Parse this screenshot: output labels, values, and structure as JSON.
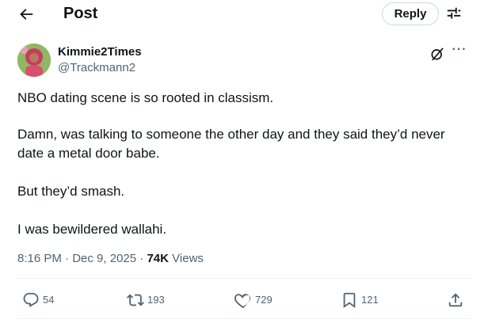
{
  "header": {
    "title": "Post",
    "reply_label": "Reply",
    "back_icon": "arrow-left-icon",
    "adjust_icon": "sliders-icon"
  },
  "author": {
    "display_name": "Kimmie2Times",
    "handle": "@Trackmann2",
    "grok_icon": "grok-icon",
    "more_label": "···"
  },
  "tweet": {
    "paragraphs": [
      "NBO dating scene is so rooted in classism.",
      "Damn, was talking to someone the other day and they said they’d never date a metal door babe.",
      "But they’d smash.",
      "I was bewildered wallahi."
    ]
  },
  "meta": {
    "time": "8:16 PM",
    "separator": " · ",
    "date": "Dec 9, 2025",
    "views_count": "74K",
    "views_label": "Views"
  },
  "actions": {
    "replies": "54",
    "reposts": "193",
    "likes": "729",
    "bookmarks": "121"
  },
  "colors": {
    "text": "#0f1419",
    "secondary": "#536471",
    "border": "#cfd9de",
    "divider": "#eff3f4"
  }
}
